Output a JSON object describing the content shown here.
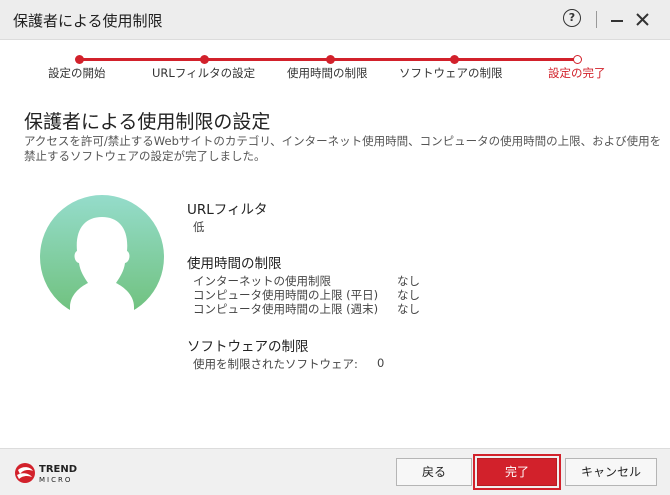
{
  "window": {
    "title": "保護者による使用制限",
    "help_label": "?"
  },
  "steps": [
    {
      "label": "設定の開始",
      "state": "done"
    },
    {
      "label": "URLフィルタの設定",
      "state": "done"
    },
    {
      "label": "使用時間の制限",
      "state": "done"
    },
    {
      "label": "ソフトウェアの制限",
      "state": "done"
    },
    {
      "label": "設定の完了",
      "state": "current"
    }
  ],
  "main": {
    "heading": "保護者による使用制限の設定",
    "description": "アクセスを許可/禁止するWebサイトのカテゴリ、インターネット使用時間、コンピュータの使用時間の上限、および使用を禁止するソフトウェアの設定が完了しました。"
  },
  "summary": {
    "url_filter": {
      "title": "URLフィルタ",
      "level": "低"
    },
    "time_limit": {
      "title": "使用時間の制限",
      "rows": [
        {
          "label": "インターネットの使用制限",
          "value": "なし"
        },
        {
          "label": "コンピュータ使用時間の上限 (平日)",
          "value": "なし"
        },
        {
          "label": "コンピュータ使用時間の上限 (週末)",
          "value": "なし"
        }
      ]
    },
    "software": {
      "title": "ソフトウェアの制限",
      "label": "使用を制限されたソフトウェア:",
      "value": "0"
    }
  },
  "footer": {
    "logo_text_top": "TREND",
    "logo_text_bottom": "MICRO",
    "back_label": "戻る",
    "finish_label": "完了",
    "cancel_label": "キャンセル"
  },
  "colors": {
    "accent": "#d2212b",
    "avatar_gradient_top": "#8fd8c5",
    "avatar_gradient_bottom": "#6cbf78"
  },
  "icons": [
    "help-icon",
    "minimize-icon",
    "close-icon",
    "user-avatar-icon",
    "trend-micro-logo"
  ]
}
